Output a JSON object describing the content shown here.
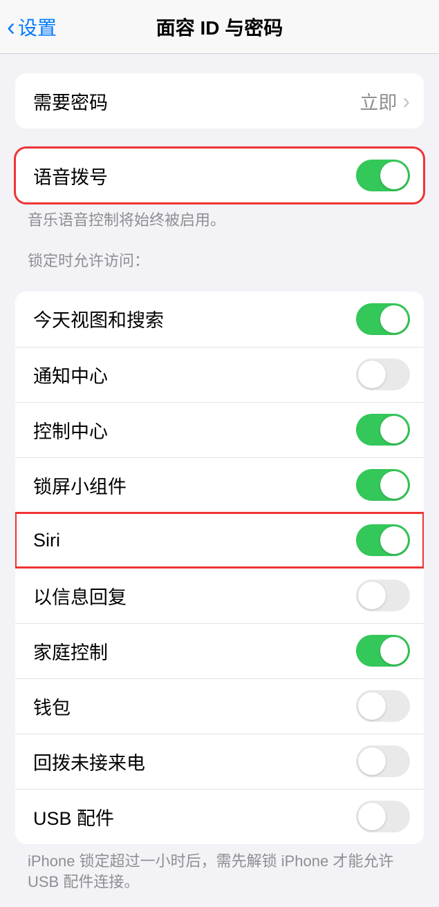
{
  "nav": {
    "back_label": "设置",
    "title": "面容 ID 与密码"
  },
  "require_passcode": {
    "label": "需要密码",
    "value": "立即"
  },
  "voice_dial": {
    "label": "语音拨号",
    "on": true,
    "footer": "音乐语音控制将始终被启用。"
  },
  "lock_access": {
    "header": "锁定时允许访问：",
    "items": [
      {
        "label": "今天视图和搜索",
        "on": true
      },
      {
        "label": "通知中心",
        "on": false
      },
      {
        "label": "控制中心",
        "on": true
      },
      {
        "label": "锁屏小组件",
        "on": true
      },
      {
        "label": "Siri",
        "on": true,
        "highlight": true
      },
      {
        "label": "以信息回复",
        "on": false
      },
      {
        "label": "家庭控制",
        "on": true
      },
      {
        "label": "钱包",
        "on": false
      },
      {
        "label": "回拨未接来电",
        "on": false
      },
      {
        "label": "USB 配件",
        "on": false
      }
    ],
    "footer": "iPhone 锁定超过一小时后，需先解锁 iPhone 才能允许 USB 配件连接。"
  }
}
